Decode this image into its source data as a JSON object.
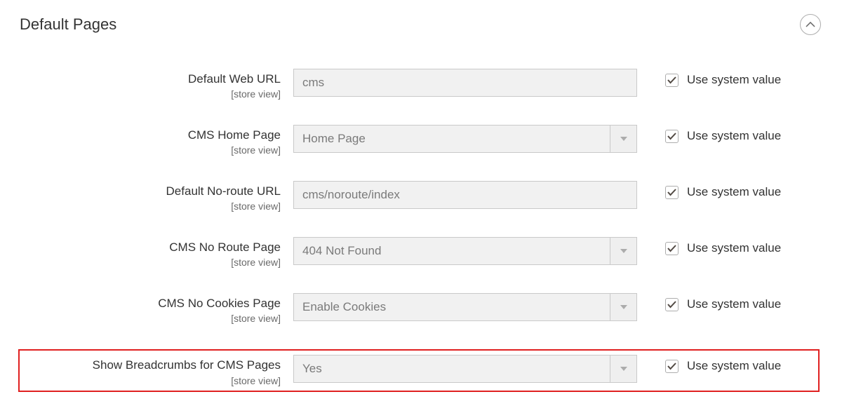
{
  "section": {
    "title": "Default Pages"
  },
  "system_value_label": "Use system value",
  "fields": [
    {
      "key": "default-web-url",
      "label": "Default Web URL",
      "scope": "[store view]",
      "type": "text",
      "value": "cms",
      "use_system": true,
      "highlighted": false
    },
    {
      "key": "cms-home-page",
      "label": "CMS Home Page",
      "scope": "[store view]",
      "type": "select",
      "value": "Home Page",
      "use_system": true,
      "highlighted": false
    },
    {
      "key": "default-noroute-url",
      "label": "Default No-route URL",
      "scope": "[store view]",
      "type": "text",
      "value": "cms/noroute/index",
      "use_system": true,
      "highlighted": false
    },
    {
      "key": "cms-no-route-page",
      "label": "CMS No Route Page",
      "scope": "[store view]",
      "type": "select",
      "value": "404 Not Found",
      "use_system": true,
      "highlighted": false
    },
    {
      "key": "cms-no-cookies-page",
      "label": "CMS No Cookies Page",
      "scope": "[store view]",
      "type": "select",
      "value": "Enable Cookies",
      "use_system": true,
      "highlighted": false
    },
    {
      "key": "show-breadcrumbs",
      "label": "Show Breadcrumbs for CMS Pages",
      "scope": "[store view]",
      "type": "select",
      "value": "Yes",
      "use_system": true,
      "highlighted": true
    }
  ]
}
